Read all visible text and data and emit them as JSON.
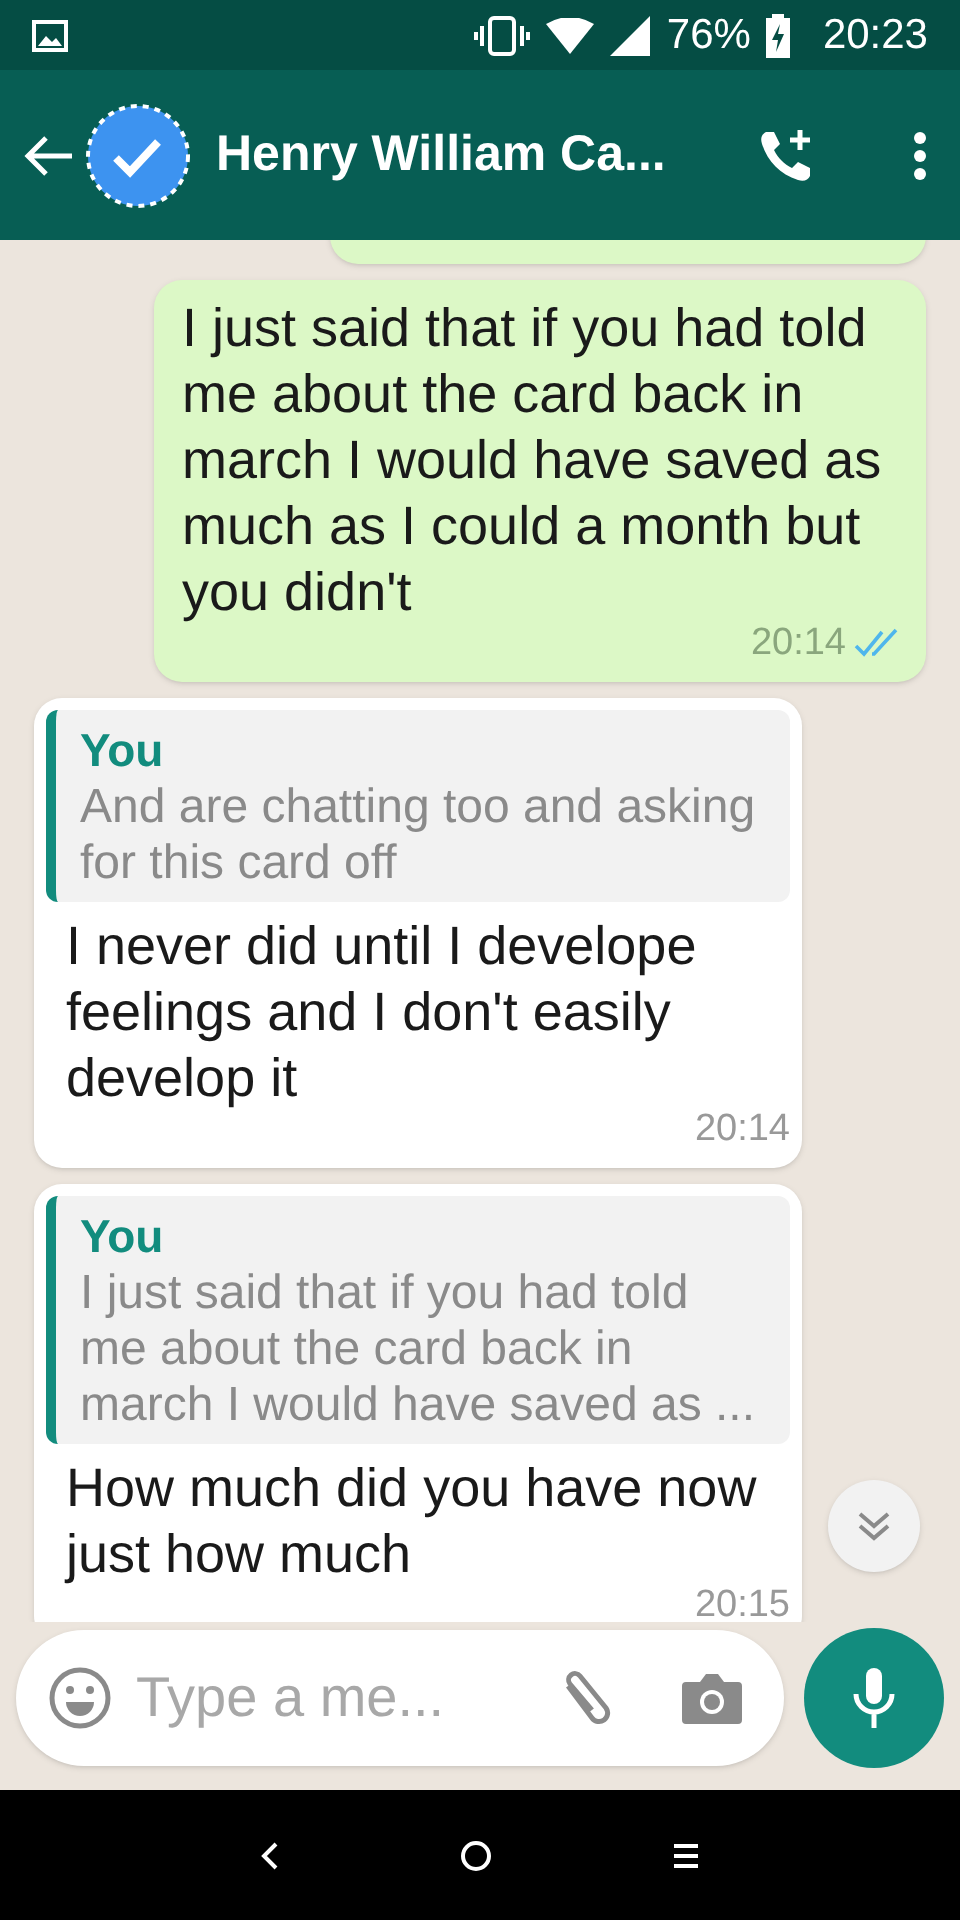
{
  "status_bar": {
    "battery": "76%",
    "time": "20:23"
  },
  "header": {
    "contact_name": "Henry William Ca..."
  },
  "messages": [
    {
      "kind": "partial",
      "outgoing": true
    },
    {
      "kind": "text",
      "outgoing": true,
      "text": "I just said that if you had told me about the card back in march I would have saved as much as I could a month but you didn't",
      "time": "20:14",
      "read": true
    },
    {
      "kind": "reply",
      "outgoing": false,
      "quote_author": "You",
      "quote_text": "And are chatting too and asking for this card off",
      "text": "I never did until I develope feelings and I don't easily develop it",
      "time": "20:14"
    },
    {
      "kind": "reply",
      "outgoing": false,
      "quote_author": "You",
      "quote_text": "I just said that if you had told me about the card back in march I would have saved as ...",
      "text": "How much did you have now just how much",
      "time": "20:15"
    }
  ],
  "composer": {
    "placeholder": "Type a me..."
  }
}
